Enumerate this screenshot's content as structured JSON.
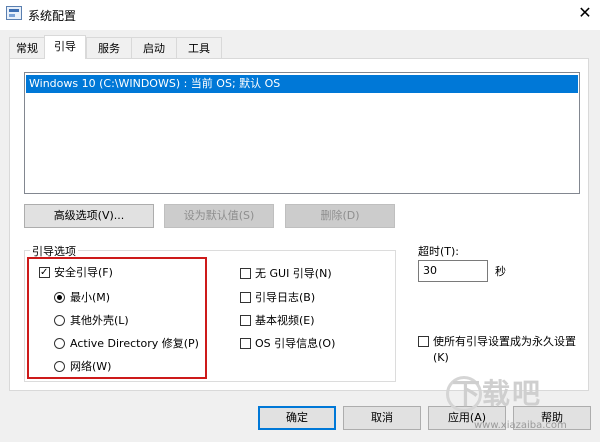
{
  "window": {
    "title": "系统配置",
    "close_glyph": "✕"
  },
  "tabs": [
    {
      "label": "常规",
      "active": false
    },
    {
      "label": "引导",
      "active": true
    },
    {
      "label": "服务",
      "active": false
    },
    {
      "label": "启动",
      "active": false
    },
    {
      "label": "工具",
      "active": false
    }
  ],
  "os_list": {
    "items": [
      "Windows 10 (C:\\WINDOWS) : 当前 OS; 默认 OS"
    ],
    "selected_index": 0
  },
  "buttons": {
    "advanced": "高级选项(V)...",
    "set_default": "设为默认值(S)",
    "delete": "删除(D)",
    "ok": "确定",
    "cancel": "取消",
    "apply": "应用(A)",
    "help": "帮助"
  },
  "boot_options": {
    "group_label": "引导选项",
    "safe_boot": {
      "label": "安全引导(F)",
      "checked": true
    },
    "radios": [
      {
        "label": "最小(M)",
        "selected": true
      },
      {
        "label": "其他外壳(L)",
        "selected": false
      },
      {
        "label": "Active Directory 修复(P)",
        "selected": false
      },
      {
        "label": "网络(W)",
        "selected": false
      }
    ],
    "right_checks": [
      {
        "label": "无 GUI 引导(N)",
        "checked": false
      },
      {
        "label": "引导日志(B)",
        "checked": false
      },
      {
        "label": "基本视频(E)",
        "checked": false
      },
      {
        "label": "OS 引导信息(O)",
        "checked": false
      }
    ]
  },
  "timeout": {
    "label": "超时(T):",
    "value": "30",
    "unit": "秒"
  },
  "permanent": {
    "label_line1": "使所有引导设置成为永久设置",
    "label_line2": "(K)",
    "checked": false
  },
  "watermark": {
    "text": "下载吧",
    "url": "www.xiazaiba.com"
  },
  "colors": {
    "selection": "#0078d7",
    "highlight_box": "#cd1a1a"
  }
}
